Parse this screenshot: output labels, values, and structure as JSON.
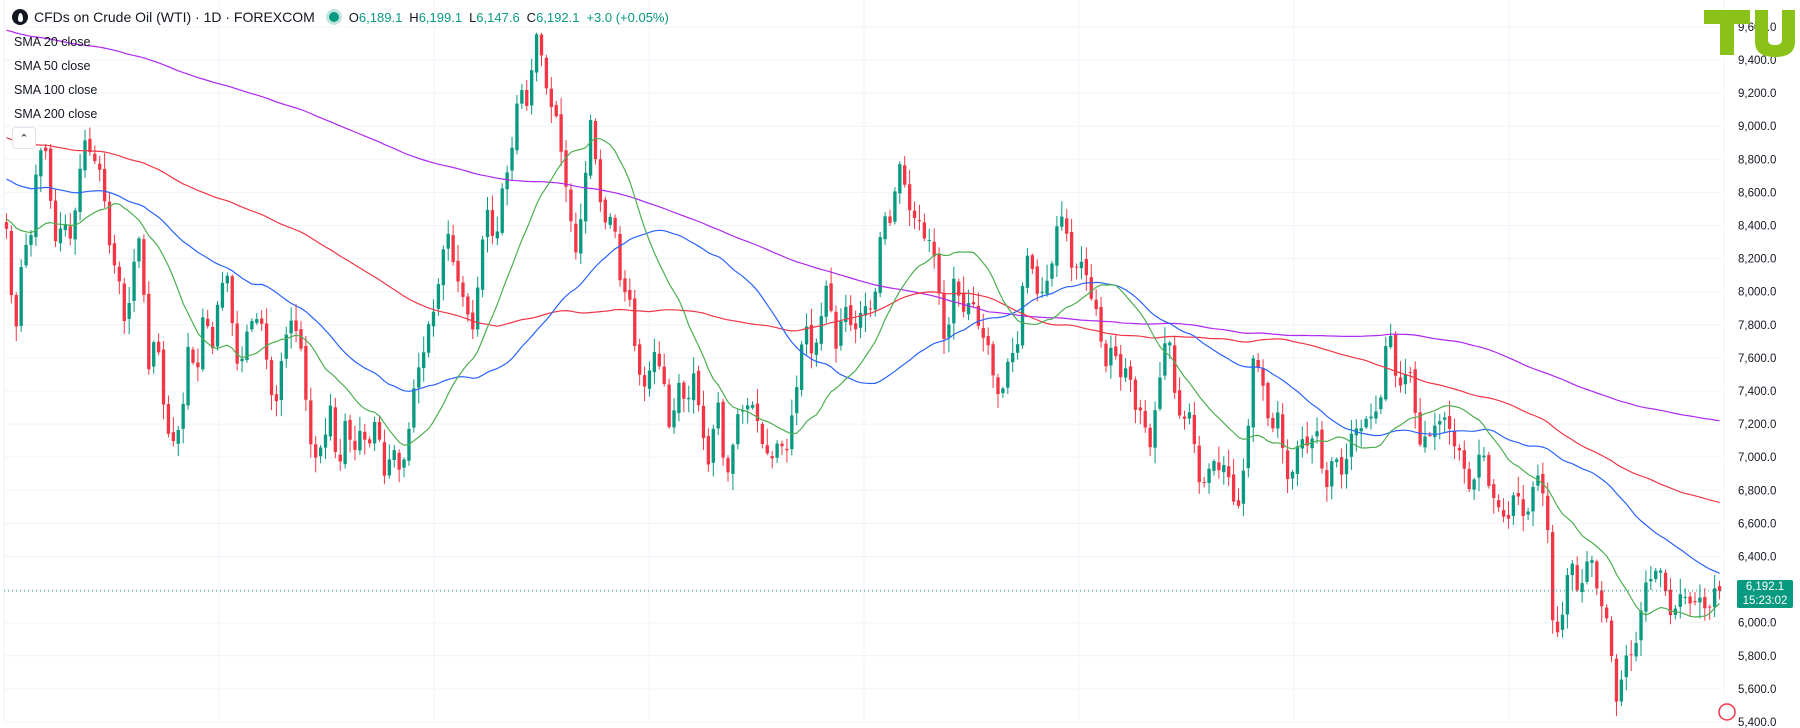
{
  "header": {
    "symbol_title": "CFDs on Crude Oil (WTI) · 1D · FOREXCOM",
    "open_key": "O",
    "open_val": "6,189.1",
    "high_key": "H",
    "high_val": "6,199.1",
    "low_key": "L",
    "low_val": "6,147.6",
    "close_key": "C",
    "close_val": "6,192.1",
    "change": "+3.0 (+0.05%)"
  },
  "indicators": [
    "SMA 20 close",
    "SMA 50 close",
    "SMA 100 close",
    "SMA 200 close"
  ],
  "price_label": {
    "price": "6,192.1",
    "countdown": "15:23:02"
  },
  "colors": {
    "up": "#089981",
    "down": "#f23645",
    "sma20": "#4caf50",
    "sma50": "#2962ff",
    "sma100": "#f23645",
    "sma200": "#b027f0",
    "logo": "#8bc21a"
  },
  "chart_data": {
    "type": "line",
    "style": "candlestick with moving averages",
    "y_axis_ticks": [
      "9,600.0",
      "9,400.0",
      "9,200.0",
      "9,000.0",
      "8,800.0",
      "8,600.0",
      "8,400.0",
      "8,200.0",
      "8,000.0",
      "7,800.0",
      "7,600.0",
      "7,400.0",
      "7,200.0",
      "7,000.0",
      "6,800.0",
      "6,600.0",
      "6,400.0",
      "6,200.0",
      "6,000.0",
      "5,800.0",
      "5,600.0",
      "5,400.0"
    ],
    "ylim": [
      5400,
      9700
    ],
    "last_price": 6192.1,
    "candle_count": 350,
    "grid": true,
    "series": [
      {
        "name": "Price",
        "values": [
          8380,
          7620,
          8250,
          8200,
          8950,
          8830,
          8380,
          8410,
          8280,
          8610,
          8850,
          8870,
          8680,
          8380,
          8120,
          7790,
          8110,
          8270,
          7560,
          7720,
          7360,
          7050,
          7200,
          7640,
          7390,
          7940,
          7560,
          8140,
          8080,
          7640,
          7580,
          7790,
          7880,
          7520,
          7350,
          7620,
          7910,
          7720,
          7290,
          6940,
          7000,
          7390,
          6830,
          7350,
          6960,
          7190,
          7040,
          7180,
          6900,
          7040,
          6990,
          7140,
          7570,
          7610,
          7830,
          8180,
          8330,
          8190,
          7900,
          7800,
          8110,
          8490,
          8260,
          8660,
          8930,
          9230,
          9180,
          9500,
          9360,
          9080,
          8950,
          8670,
          8180,
          8620,
          8980,
          8630,
          8340,
          8410,
          8020,
          7940,
          7610,
          7340,
          7680,
          7450,
          7150,
          7470,
          7300,
          7600,
          7140,
          6980,
          7310,
          6870,
          7050,
          7320,
          7400,
          7220,
          7100,
          6910,
          7120,
          7000,
          7410,
          7890,
          7610,
          7850,
          7990,
          7660,
          7850,
          7810,
          7870,
          7910,
          8030,
          8400,
          8440,
          8700,
          8620,
          8450,
          8390,
          8380,
          8000,
          7660,
          7990,
          7920,
          7930,
          7860,
          7780,
          7460,
          7390,
          7510,
          7670,
          8170,
          8180,
          7990,
          8060,
          8420,
          8360,
          8150,
          8120,
          8120,
          7920,
          7560,
          7720,
          7400,
          7600,
          7210,
          7320,
          7040,
          7500,
          7840,
          7330,
          7230,
          7180,
          6910,
          6840,
          7040,
          6970,
          6810,
          6690,
          6900,
          7690,
          7430,
          7240,
          7290,
          6890,
          6930,
          7040,
          7110,
          7110,
          6870,
          7010,
          6920,
          7060,
          7110,
          7240,
          7170,
          7400,
          7810,
          7530,
          7460,
          7450,
          7070,
          7040,
          7270,
          7220,
          7220,
          7030,
          6800,
          6870,
          6990,
          6840,
          6670,
          6690,
          6780,
          6660,
          6690,
          6830,
          6800,
          5840,
          6110,
          6380,
          6220,
          6300,
          6310,
          6120,
          5910,
          5590,
          5760,
          5860,
          6010,
          6250,
          6320,
          6190,
          6100,
          6150,
          6220,
          6080,
          6090,
          6100,
          6190
        ]
      },
      {
        "name": "SMA 20"
      },
      {
        "name": "SMA 50"
      },
      {
        "name": "SMA 100"
      },
      {
        "name": "SMA 200"
      }
    ]
  }
}
